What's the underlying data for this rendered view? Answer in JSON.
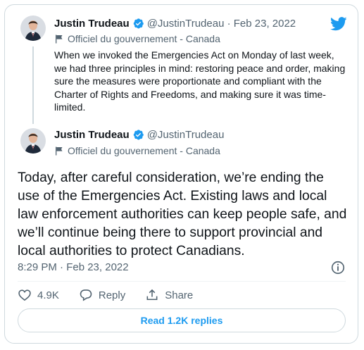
{
  "quoted_tweet": {
    "author_name": "Justin Trudeau",
    "handle_and_date": "@JustinTrudeau · Feb 23, 2022",
    "account_label": "Officiel du gouvernement - Canada",
    "text": "When we invoked the Emergencies Act on Monday of last week, we had three principles in mind: restoring peace and order, making sure the measures were proportionate and compliant with the Charter of Rights and Freedoms, and making sure it was time-limited."
  },
  "main_tweet": {
    "author_name": "Justin Trudeau",
    "handle": "@JustinTrudeau",
    "account_label": "Officiel du gouvernement - Canada",
    "text": "Today, after careful consideration, we’re ending the use of the Emergencies Act. Existing laws and local law enforcement authorities can keep people safe, and we’ll continue being there to support provincial and local authorities to protect Canadians.",
    "timestamp": "8:29 PM · Feb 23, 2022"
  },
  "actions": {
    "like_count": "4.9K",
    "reply_label": "Reply",
    "share_label": "Share"
  },
  "read_replies_label": "Read 1.2K replies",
  "colors": {
    "accent": "#1d9bf0",
    "text": "#0f1419",
    "secondary": "#536471",
    "border": "#cfd9de"
  },
  "icons": [
    "twitter-bird-icon",
    "verified-badge-icon",
    "government-flag-icon",
    "info-icon",
    "heart-icon",
    "reply-icon",
    "share-icon"
  ]
}
